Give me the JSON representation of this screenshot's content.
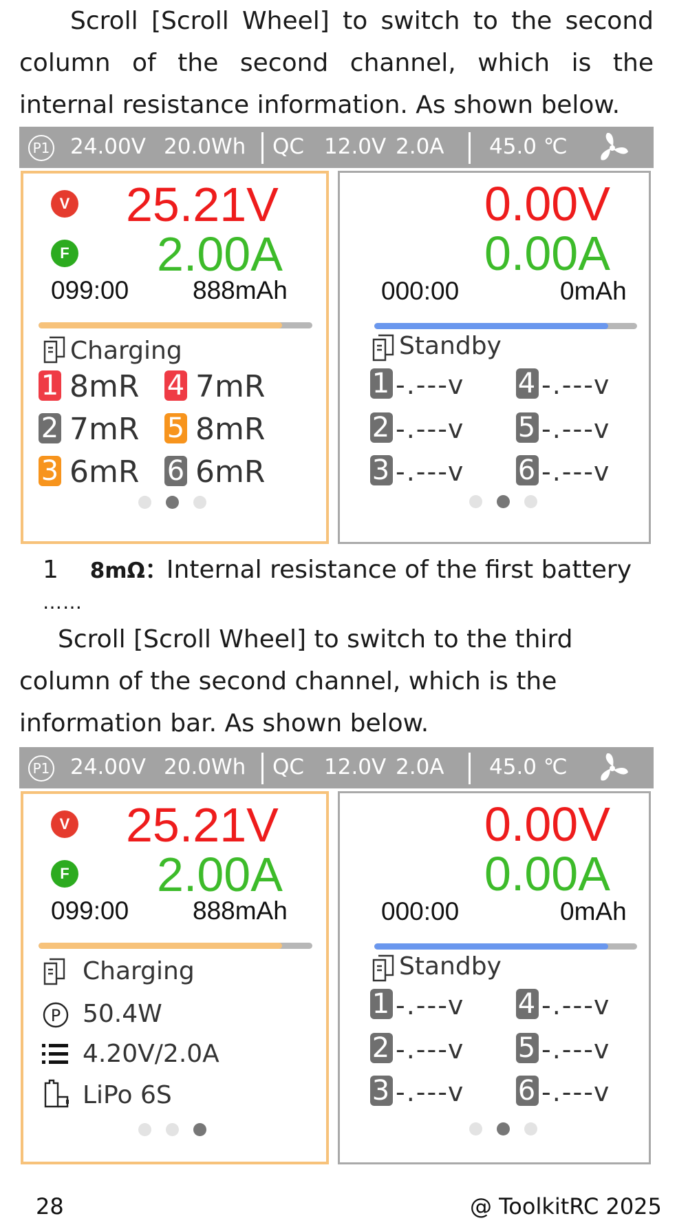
{
  "intro_1": "Scroll [Scroll Wheel] to switch to the second column of the second channel, which is the internal resistance information. As shown below.",
  "intro_2": "Scroll [Scroll Wheel] to switch to the third column of the second channel, which is the information bar. As shown below.",
  "note": {
    "index": "1",
    "value": "8mΩ：",
    "text": "Internal resistance of the first battery",
    "ellipsis": "……"
  },
  "status_bar": {
    "profile": "P1",
    "voltage": "24.00V",
    "energy": "20.0Wh",
    "qc_label": "QC",
    "qc_voltage": "12.0V",
    "qc_current": "2.0A",
    "temperature": "45.0 ℃",
    "icons": [
      "fan-icon"
    ]
  },
  "channel_1": {
    "voltage": "25.21V",
    "current": "2.00A",
    "v_badge": "V",
    "f_badge": "F",
    "time": "099:00",
    "capacity": "888mAh",
    "progress": 0.89,
    "progress_color": "#f7c27a",
    "status": "Charging",
    "resistance": [
      {
        "n": "1",
        "value": "8mR",
        "color": "#ef3b45"
      },
      {
        "n": "4",
        "value": "7mR",
        "color": "#ef3b45"
      },
      {
        "n": "2",
        "value": "7mR",
        "color": "#6f6f6f"
      },
      {
        "n": "5",
        "value": "8mR",
        "color": "#f7941d"
      },
      {
        "n": "3",
        "value": "6mR",
        "color": "#f7941d"
      },
      {
        "n": "6",
        "value": "6mR",
        "color": "#6f6f6f"
      }
    ],
    "info": {
      "power_label": "P",
      "power": "50.4W",
      "setting": "4.20V/2.0A",
      "battery": "LiPo 6S"
    }
  },
  "channel_2": {
    "voltage": "0.00V",
    "current": "0.00A",
    "time": "000:00",
    "capacity": "0mAh",
    "progress": 0.89,
    "progress_color": "#6a97ee",
    "status": "Standby",
    "cells": [
      {
        "n": "1",
        "value": "-.---v"
      },
      {
        "n": "4",
        "value": "-.---v"
      },
      {
        "n": "2",
        "value": "-.---v"
      },
      {
        "n": "5",
        "value": "-.---v"
      },
      {
        "n": "3",
        "value": "-.---v"
      },
      {
        "n": "6",
        "value": "-.---v"
      }
    ]
  },
  "screen_1_left_page": 2,
  "screen_2_left_page": 3,
  "right_page": 2,
  "page_number": "28",
  "copyright": "@ ToolkitRC 2025"
}
